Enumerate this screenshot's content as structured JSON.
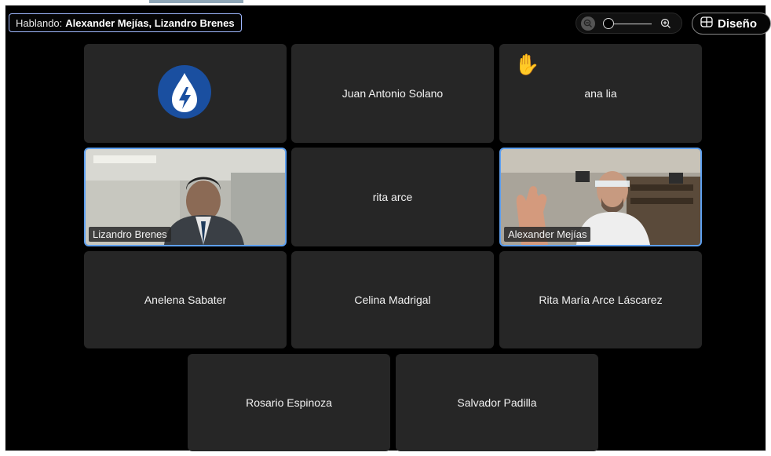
{
  "speaking": {
    "prefix": "Hablando:",
    "names": "Alexander Mejías, Lizandro Brenes"
  },
  "zoom_controls": {
    "zoom_out_icon": "zoom-out-icon",
    "zoom_in_icon": "zoom-in-icon"
  },
  "layout_button": {
    "icon": "grid-layout-icon",
    "label": "Diseño"
  },
  "participants": [
    {
      "name": "",
      "type": "logo",
      "logo_colors": [
        "#1a4fa0",
        "#ffffff"
      ]
    },
    {
      "name": "Juan Antonio Solano",
      "type": "name"
    },
    {
      "name": "ana lia",
      "type": "name",
      "raised_hand": "✋"
    },
    {
      "name": "Lizandro Brenes",
      "type": "video",
      "speaking": true
    },
    {
      "name": "rita arce",
      "type": "name"
    },
    {
      "name": "Alexander Mejías",
      "type": "video",
      "speaking": true
    },
    {
      "name": "Anelena Sabater",
      "type": "name"
    },
    {
      "name": "Celina Madrigal",
      "type": "name"
    },
    {
      "name": "Rita María Arce Láscarez",
      "type": "name"
    },
    {
      "name": "Rosario Espinoza",
      "type": "name"
    },
    {
      "name": "Salvador Padilla",
      "type": "name"
    }
  ],
  "colors": {
    "tile_bg": "#262626",
    "active_border": "#5ea0f0",
    "speaking_border": "#9fb8ff"
  }
}
